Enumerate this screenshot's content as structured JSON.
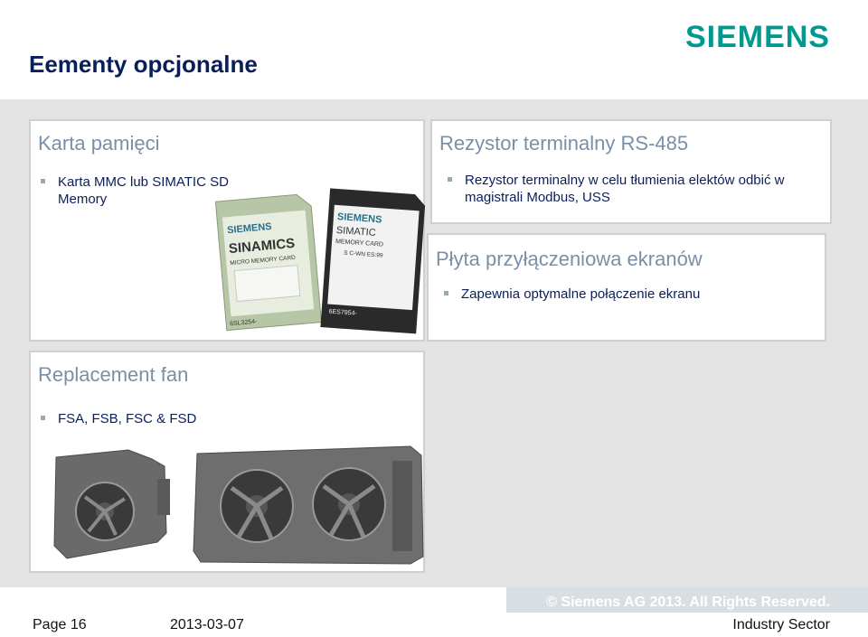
{
  "header": {
    "title": "Eementy opcjonalne",
    "logo": "SIEMENS"
  },
  "panels": {
    "card": {
      "title": "Karta pamięci",
      "bullet": "Karta MMC lub SIMATIC SD Memory",
      "card1": {
        "brand": "SIEMENS",
        "product": "SINAMICS",
        "sub": "MICRO MEMORY CARD",
        "code": "6SL3254-"
      },
      "card2": {
        "brand": "SIEMENS",
        "product": "SIMATIC",
        "sub": "MEMORY CARD",
        "info": "S C-WN  ES:99",
        "code": "6ES7954-"
      }
    },
    "resistor": {
      "title": "Rezystor terminalny RS-485",
      "bullet": "Rezystor terminalny w celu tłumienia elektów odbić w magistrali Modbus, USS"
    },
    "shield": {
      "title": "Płyta przyłączeniowa ekranów",
      "bullet": "Zapewnia optymalne połączenie ekranu"
    },
    "fan": {
      "title": "Replacement fan",
      "bullet": "FSA, FSB, FSC & FSD"
    }
  },
  "footer": {
    "page": "Page 16",
    "date": "2013-03-07",
    "copyright": "© Siemens AG 2013. All Rights Reserved.",
    "sector": "Industry Sector"
  },
  "colors": {
    "brand": "#00998f",
    "title": "#0a1e5a",
    "panel_title": "#7a8fa8"
  }
}
